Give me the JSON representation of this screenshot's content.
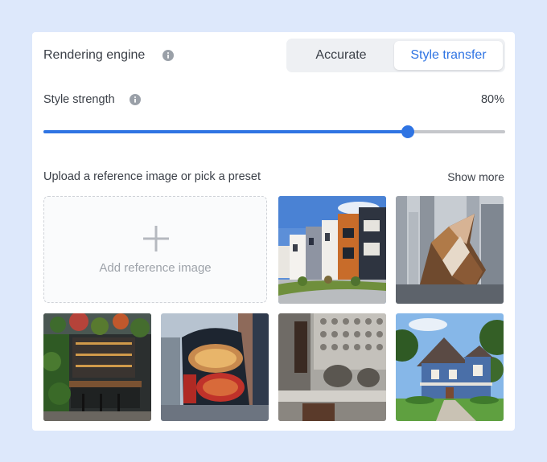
{
  "engine": {
    "label": "Rendering engine",
    "options": [
      "Accurate",
      "Style transfer"
    ],
    "selected": "Style transfer"
  },
  "strength": {
    "label": "Style strength",
    "value_text": "80%",
    "value_fraction": 0.79
  },
  "reference": {
    "label": "Upload a reference image or pick a preset",
    "show_more": "Show more",
    "add_label": "Add reference image"
  },
  "colors": {
    "page_bg": "#dde8fb",
    "accent": "#2f74e3",
    "text": "#3b4048",
    "muted": "#9ea3aa"
  },
  "presets": [
    {
      "icon": "townhouses-photo"
    },
    {
      "icon": "metal-sculpture-skyscrapers-photo"
    },
    {
      "icon": "garden-bar-photo"
    },
    {
      "icon": "red-round-window-building-photo"
    },
    {
      "icon": "concrete-brutalist-facade-photo"
    },
    {
      "icon": "blue-house-photo"
    }
  ]
}
